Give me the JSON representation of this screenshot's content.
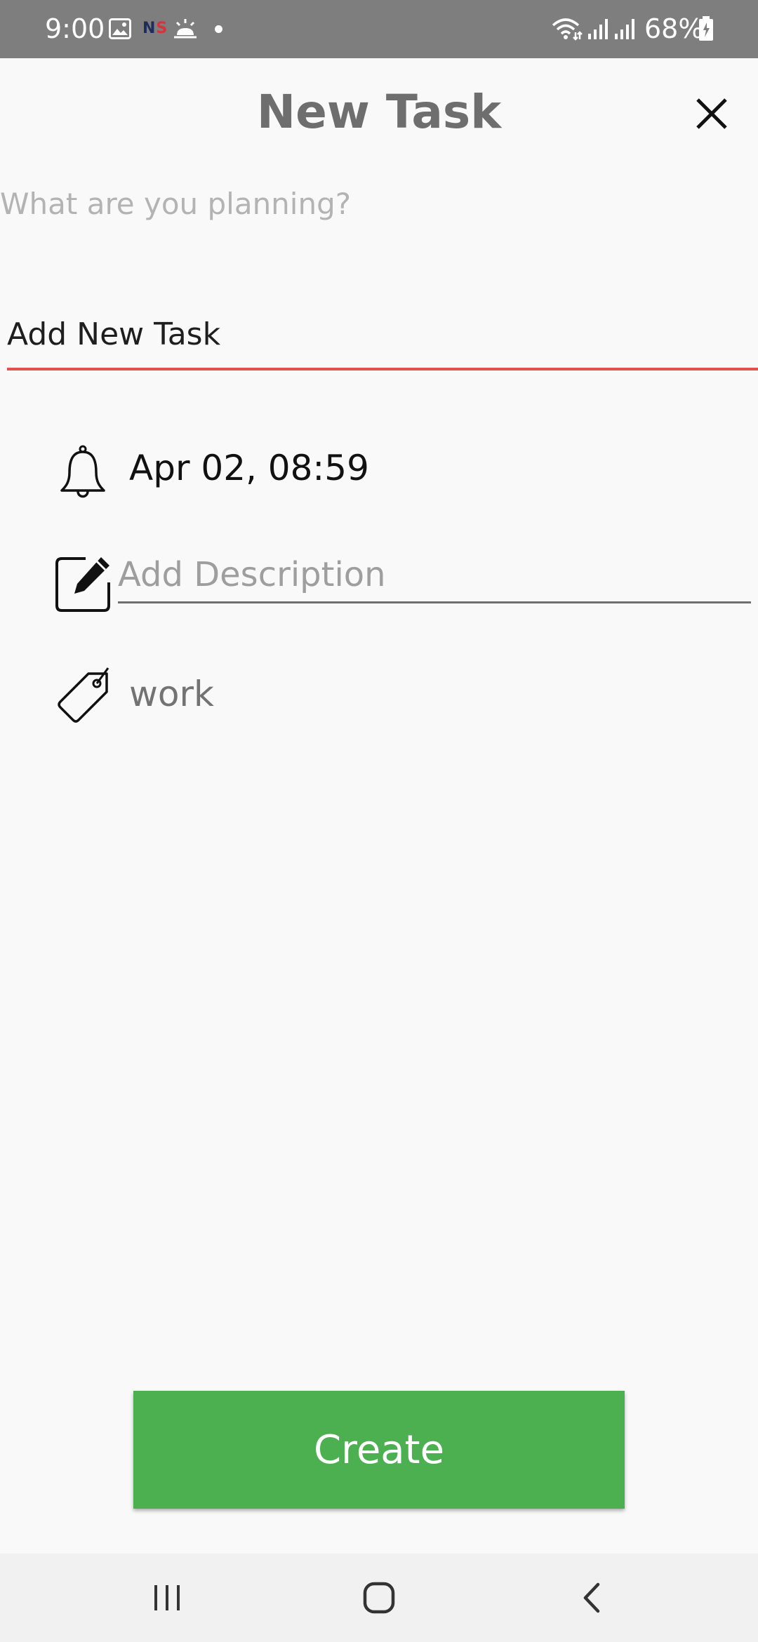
{
  "status_bar": {
    "time": "9:00",
    "ns_badge_n": "N",
    "ns_badge_s": "S",
    "battery_percent": "68%",
    "icons": [
      "gallery-icon",
      "ns-app-icon",
      "weather-icon",
      "notification-dot",
      "wifi-icon",
      "signal-icon",
      "signal-icon",
      "battery-icon"
    ]
  },
  "header": {
    "title": "New Task",
    "close_icon": "close-icon"
  },
  "form": {
    "planning_label": "What are you planning?",
    "task_name_value": "Add New Task",
    "reminder_datetime": "Apr 02, 08:59",
    "description_placeholder": "Add Description",
    "description_value": "",
    "category": "work",
    "underline_color": "#e0524a"
  },
  "actions": {
    "create_label": "Create",
    "create_color": "#4caf50"
  },
  "nav_bar": {
    "buttons": [
      "recent-apps",
      "home",
      "back"
    ]
  }
}
